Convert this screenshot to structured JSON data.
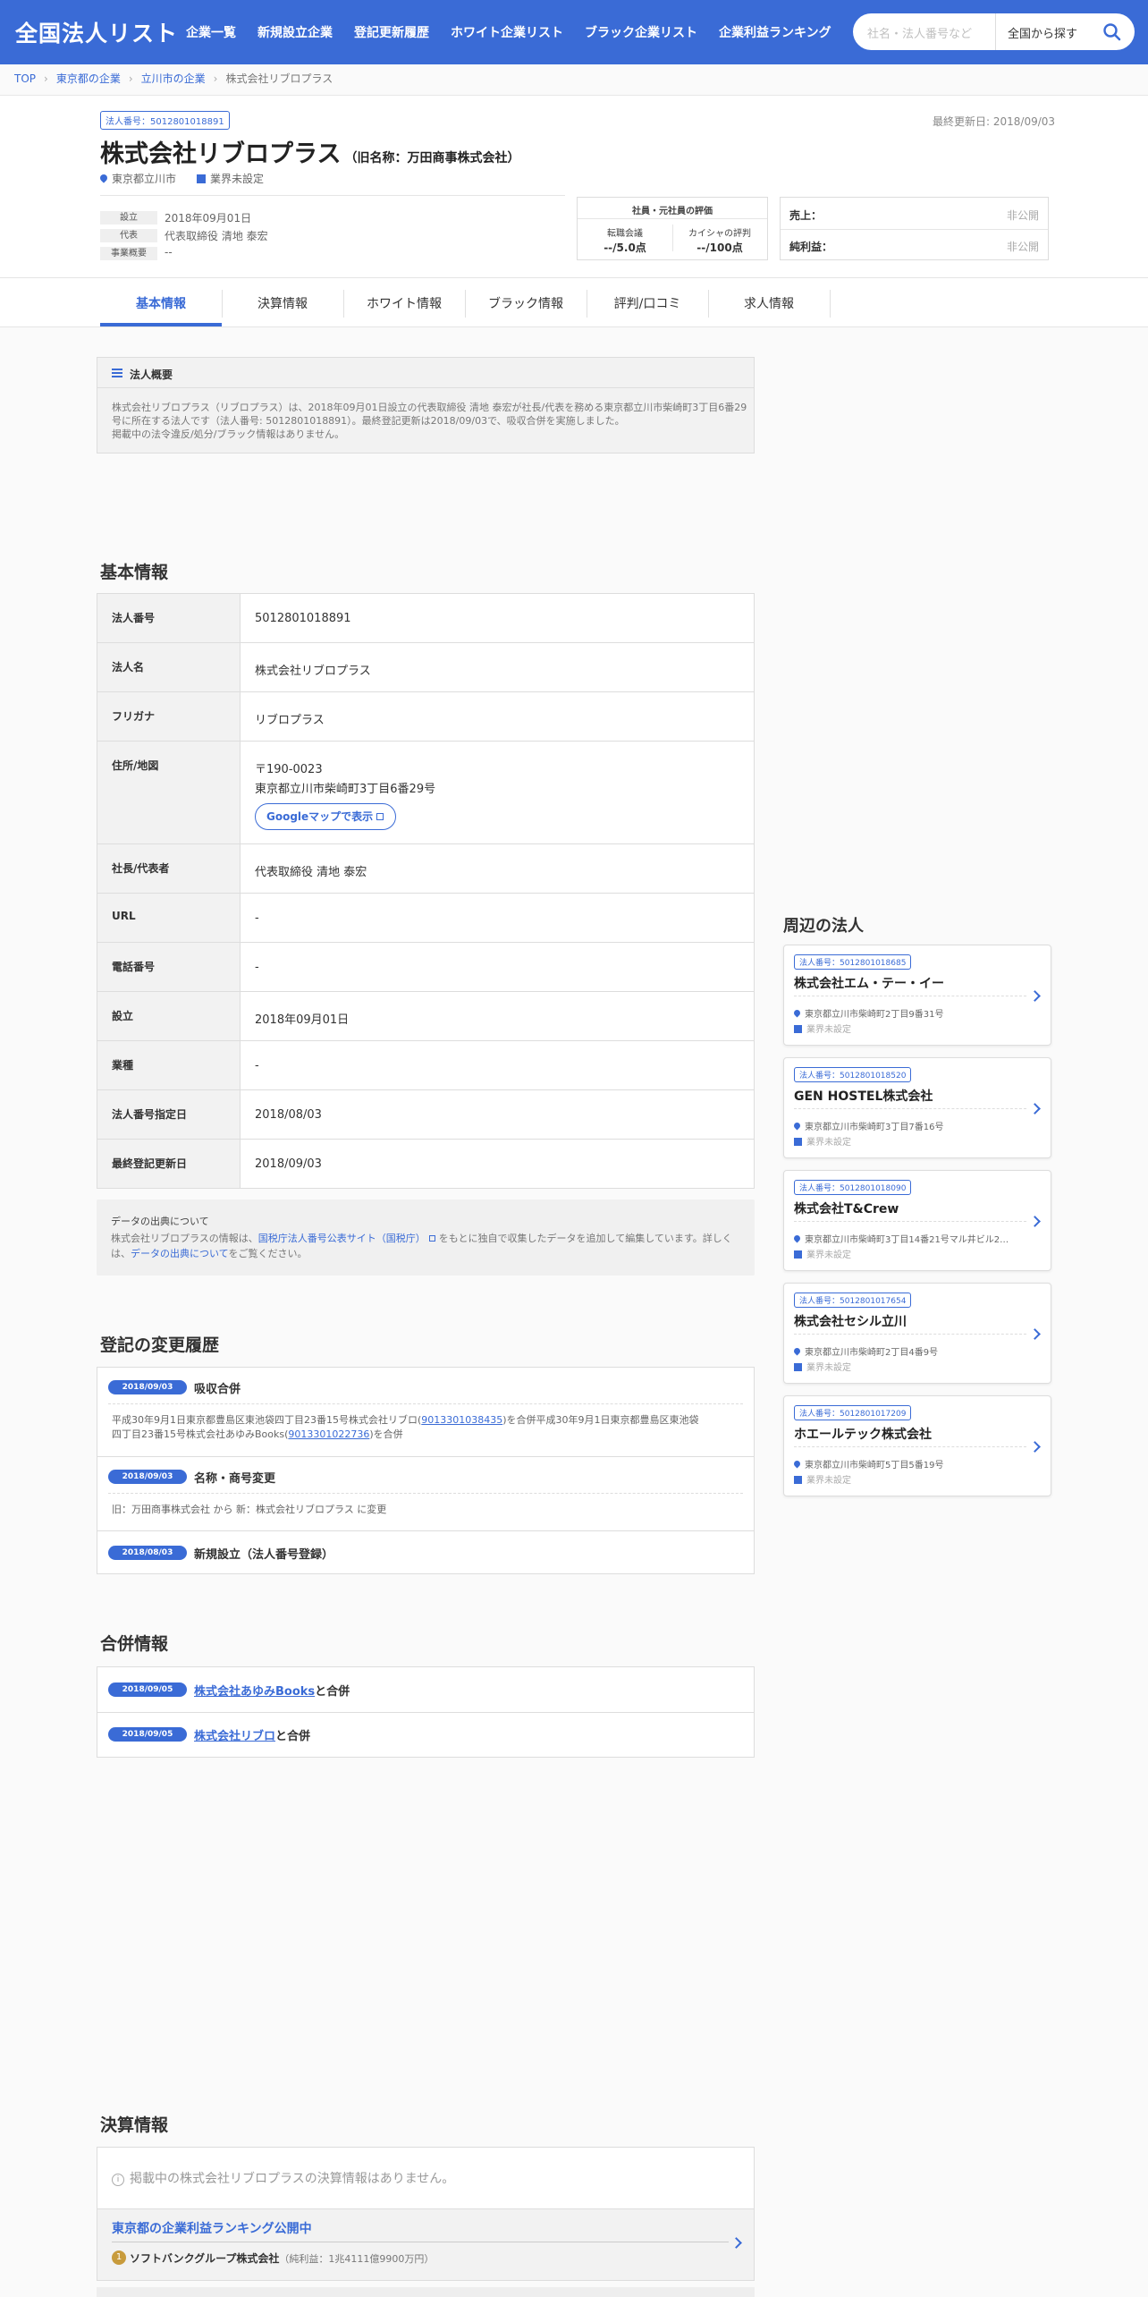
{
  "header": {
    "logo": "全国法人リスト",
    "nav": [
      "企業一覧",
      "新規設立企業",
      "登記更新履歴",
      "ホワイト企業リスト",
      "ブラック企業リスト",
      "企業利益ランキング"
    ],
    "search_placeholder": "社名・法人番号など",
    "search_scope": "全国から探す"
  },
  "breadcrumb": [
    "TOP",
    "東京都の企業",
    "立川市の企業",
    "株式会社リブロプラス"
  ],
  "company": {
    "number_badge": "法人番号：5012801018891",
    "name": "株式会社リブロプラス",
    "old_name": "（旧名称：万田商事株式会社）",
    "updated": "最終更新日: 2018/09/03",
    "location": "東京都立川市",
    "industry": "業界未設定",
    "facts": [
      {
        "label": "設立",
        "value": "2018年09月01日"
      },
      {
        "label": "代表",
        "value": "代表取締役 清地 泰宏"
      },
      {
        "label": "事業概要",
        "value": "--"
      }
    ],
    "eval": {
      "title": "社員・元社員の評価",
      "items": [
        {
          "label": "転職会議",
          "value": "--/5.0点"
        },
        {
          "label": "カイシャの評判",
          "value": "--/100点"
        }
      ]
    },
    "finance": [
      {
        "label": "売上：",
        "value": "非公開"
      },
      {
        "label": "純利益：",
        "value": "非公開"
      }
    ]
  },
  "tabs": [
    "基本情報",
    "決算情報",
    "ホワイト情報",
    "ブラック情報",
    "評判/口コミ",
    "求人情報"
  ],
  "overview": {
    "title": "法人概要",
    "lines": [
      "株式会社リブロプラス（リブロプラス）は、2018年09月01日設立の代表取締役 清地 泰宏が社長/代表を務める東京都立川市柴崎町3丁目6番29",
      "号に所在する法人です（法人番号: 5012801018891）。最終登記更新は2018/09/03で、吸収合併を実施しました。",
      "掲載中の法令違反/処分/ブラック情報はありません。"
    ]
  },
  "basic": {
    "heading": "基本情報",
    "rows": [
      {
        "label": "法人番号",
        "value": "5012801018891"
      },
      {
        "label": "法人名",
        "value": "株式会社リブロプラス"
      },
      {
        "label": "フリガナ",
        "value": "リブロプラス"
      },
      {
        "label": "住所/地図",
        "value": "〒190-0023",
        "value2": "東京都立川市柴崎町3丁目6番29号"
      },
      {
        "label": "社長/代表者",
        "value": "代表取締役 清地 泰宏"
      },
      {
        "label": "URL",
        "value": "-"
      },
      {
        "label": "電話番号",
        "value": "-"
      },
      {
        "label": "設立",
        "value": "2018年09月01日"
      },
      {
        "label": "業種",
        "value": "-"
      },
      {
        "label": "法人番号指定日",
        "value": "2018/08/03"
      },
      {
        "label": "最終登記更新日",
        "value": "2018/09/03"
      }
    ],
    "map_button": "Googleマップで表示"
  },
  "source": {
    "title": "データの出典について",
    "line1_pre": "株式会社リブロプラスの情報は、",
    "line1_link": "国税庁法人番号公表サイト（国税庁）",
    "line1_post": "をもとに独自で収集したデータを追加して編集しています。詳しく",
    "line2_pre": "は、",
    "line2_link": "データの出典について",
    "line2_post": "をご覧ください。"
  },
  "history": {
    "heading": "登記の変更履歴",
    "items": [
      {
        "date": "2018/09/03",
        "title": "吸収合併",
        "d1_pre": "平成30年9月1日東京都豊島区東池袋四丁目23番15号株式会社リブロ(",
        "d1_link": "9013301038435",
        "d1_post": ")を合併平成30年9月1日東京都豊島区東池袋",
        "d2_pre": "四丁目23番15号株式会社あゆみBooks(",
        "d2_link": "9013301022736",
        "d2_post": ")を合併"
      },
      {
        "date": "2018/09/03",
        "title": "名称・商号変更",
        "detail": "旧：万田商事株式会社 から 新：株式会社リブロプラス に変更"
      },
      {
        "date": "2018/08/03",
        "title": "新規設立（法人番号登録）"
      }
    ]
  },
  "merger": {
    "heading": "合併情報",
    "items": [
      {
        "date": "2018/09/05",
        "link": "株式会社あゆみBooks",
        "suffix": "と合併"
      },
      {
        "date": "2018/09/05",
        "link": "株式会社リブロ",
        "suffix": "と合併"
      }
    ]
  },
  "financial": {
    "heading": "決算情報",
    "notice": "掲載中の株式会社リブロプラスの決算情報はありません。",
    "ranking_title": "東京都の企業利益ランキング公開中",
    "rank_no": "1",
    "rank_company": "ソフトバンクグループ株式会社",
    "rank_note": "（純利益：1兆4111億9900万円）"
  },
  "nearby": {
    "heading": "周辺の法人",
    "items": [
      {
        "badge": "法人番号：5012801018685",
        "name": "株式会社エム・テー・イー",
        "addr": "東京都立川市柴崎町2丁目9番31号",
        "ind": "業界未設定"
      },
      {
        "badge": "法人番号：5012801018520",
        "name": "GEN HOSTEL株式会社",
        "addr": "東京都立川市柴崎町3丁目7番16号",
        "ind": "業界未設定"
      },
      {
        "badge": "法人番号：5012801018090",
        "name": "株式会社T&Crew",
        "addr": "東京都立川市柴崎町3丁目14番21号マル井ビル2…",
        "ind": "業界未設定"
      },
      {
        "badge": "法人番号：5012801017654",
        "name": "株式会社セシル立川",
        "addr": "東京都立川市柴崎町2丁目4番9号",
        "ind": "業界未設定"
      },
      {
        "badge": "法人番号：5012801017209",
        "name": "ホエールテック株式会社",
        "addr": "東京都立川市柴崎町5丁目5番19号",
        "ind": "業界未設定"
      }
    ]
  }
}
